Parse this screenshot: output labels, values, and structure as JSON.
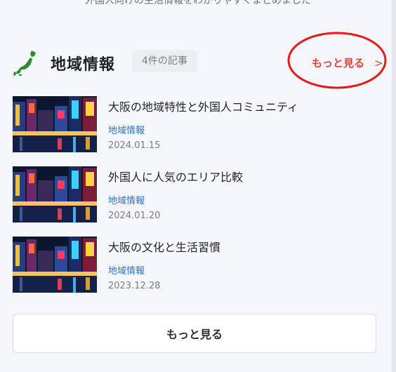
{
  "section": {
    "top_text": "外国人向けの生活情報をわかりやすくまとめました",
    "title": "地域情報",
    "count_badge": "4件の記事",
    "more_link": "もっと見る",
    "more_link_chevron": ">",
    "icon": "japan-map-icon",
    "accent_color": "#e0453a",
    "category_color": "#3a6fb7"
  },
  "articles": [
    {
      "title": "大阪の地域特性と外国人コミュニティ",
      "category": "地域情報",
      "date": "2024.01.15"
    },
    {
      "title": "外国人に人気のエリア比較",
      "category": "地域情報",
      "date": "2024.01.20"
    },
    {
      "title": "大阪の文化と生活習慣",
      "category": "地域情報",
      "date": "2023.12.28"
    }
  ],
  "footer": {
    "more_button": "もっと見る"
  }
}
